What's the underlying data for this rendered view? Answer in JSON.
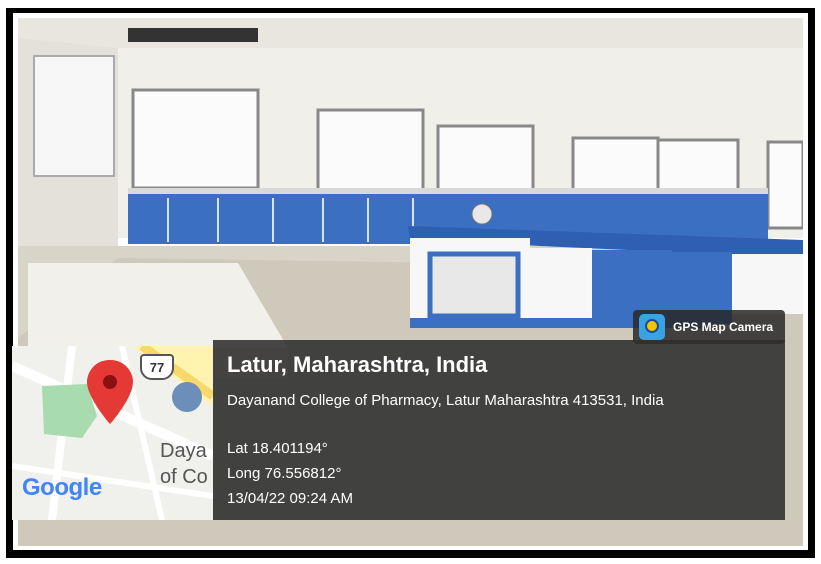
{
  "gps_badge": {
    "label": "GPS Map Camera",
    "icon": "gps-map-camera-icon"
  },
  "location": {
    "title": "Latur, Maharashtra, India",
    "address": "Dayanand College of Pharmacy, Latur Maharashtra 413531, India",
    "lat": "Lat 18.401194°",
    "long": "Long 76.556812°",
    "timestamp": "13/04/22 09:24 AM"
  },
  "map": {
    "highway_shield": "77",
    "poi_label_line1": "Daya",
    "poi_label_line2": "of Co",
    "attribution": "Google",
    "pin_icon": "map-pin-icon",
    "poi_icon": "graduation-cap-icon",
    "colors": {
      "pin": "#e53935",
      "park": "#a8dbae",
      "water_poi": "#6b8fb8"
    }
  },
  "colors": {
    "cabinet_blue": "#3a6fc2",
    "overlay": "#2d2d2d",
    "frame": "#000000"
  }
}
